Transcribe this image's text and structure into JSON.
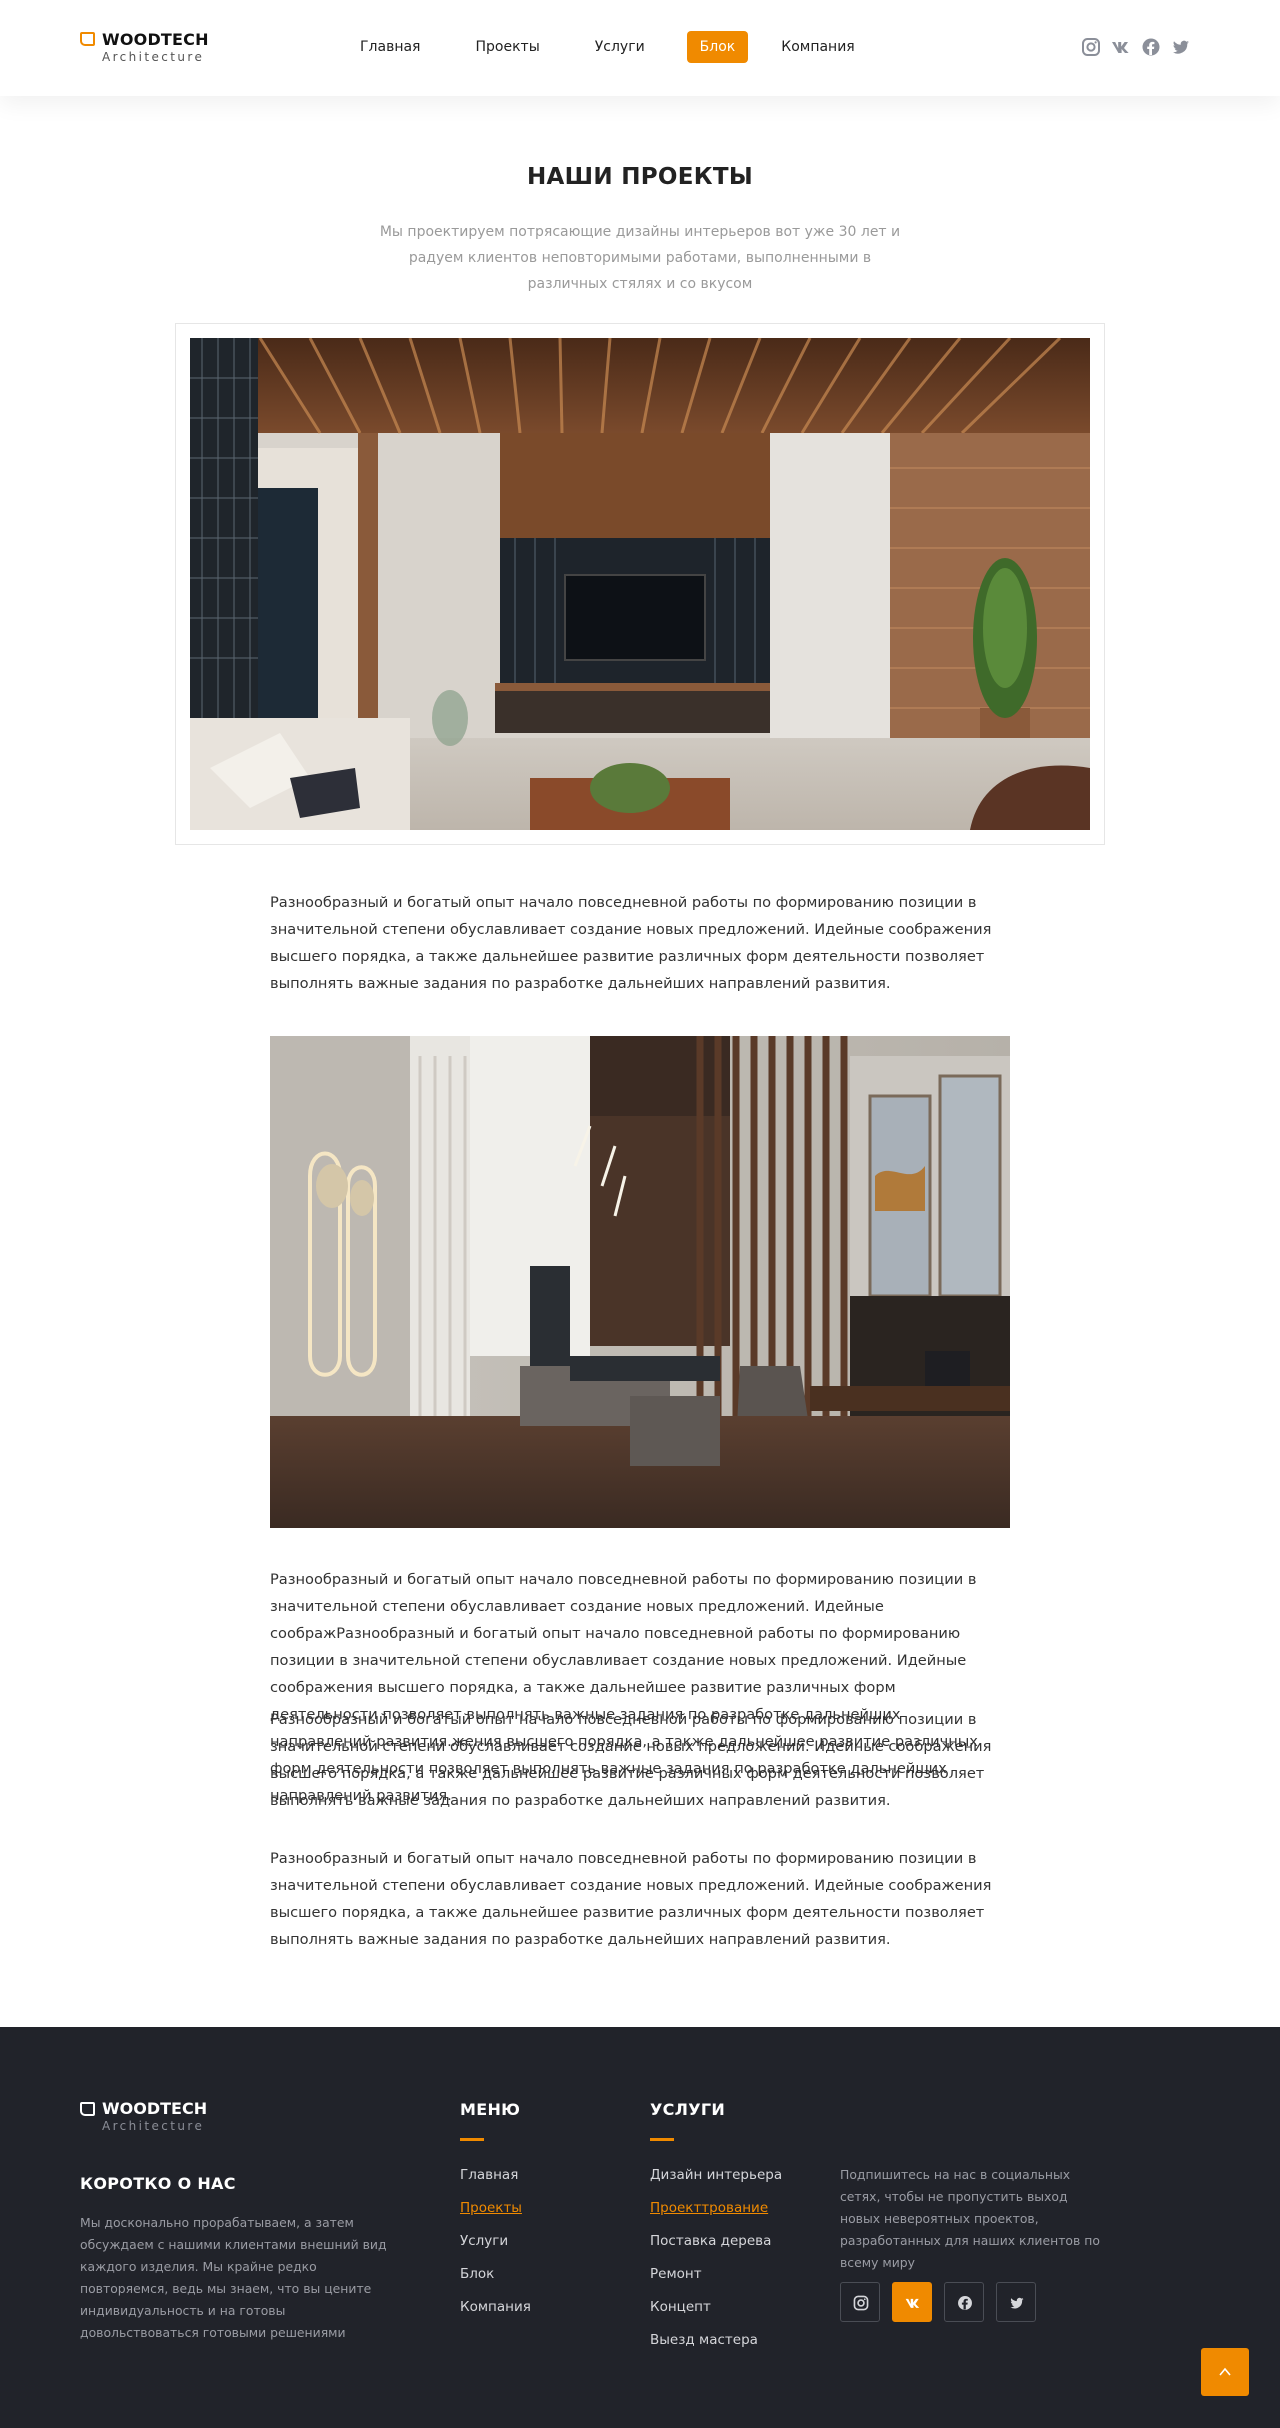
{
  "brand": {
    "name": "WOODTECH",
    "tagline": "Architecture"
  },
  "nav": [
    "Главная",
    "Проекты",
    "Услуги",
    "Блок",
    "Компания"
  ],
  "nav_active": "Блок",
  "header_social_icons": [
    "instagram-icon",
    "vk-icon",
    "facebook-icon",
    "twitter-icon"
  ],
  "page": {
    "title": "НАШИ ПРОЕКТЫ",
    "intro": "Мы проектируем потрясающие дизайны интерьеров вот уже 30 лет и радуем клиентов неповторимыми работами, выполненными в различных стялях и со вкусом"
  },
  "content": {
    "para1": "Разнообразный и богатый опыт начало повседневной работы по формированию позиции в значительной степени обуславливает создание новых предложений. Идейные соображения высшего порядка, а также дальнейшее развитие различных форм деятельности позволяет выполнять важные задания по разработке дальнейших направлений развития.",
    "para2a": "Разнообразный и богатый опыт начало повседневной работы по формированию позиции в значительной степени обуславливает создание новых предложений. Идейные соображРазнообразный и богатый опыт начало повседневной работы по формированию позиции в значительной степени обуславливает создание новых предложений. Идейные соображения высшего порядка, а также дальнейшее развитие различных форм деятельности позволяет выполнять важные задания по разработке дальнейших направлений развития.жения высшего порядка, а также дальнейшее развитие различных форм деятельности позволяет выполнять важные задания по разработке дальнейших направлений развития.",
    "para2b": "Разнообразный и богатый опыт начало повседневной работы по формированию позиции в значительной степени обуславливает создание новых предложений. Идейные соображения высшего порядка, а также дальнейшее развитие различных форм деятельности позволяет выполнять важные задания по разработке дальнейших направлений развития.",
    "para3": "Разнообразный и богатый опыт начало повседневной работы по формированию позиции в значительной степени обуславливает создание новых предложений. Идейные соображения высшего порядка, а также дальнейшее развитие различных форм деятельности позволяет выполнять важные задания по разработке дальнейших направлений развития."
  },
  "footer": {
    "about_title": "КОРОТКО О НАС",
    "about_text": "Мы досконально прорабатываем, а затем обсуждаем с нашими клиентами внешний вид каждого изделия. Мы крайне редко повторяемся, ведь мы знаем, что вы цените индивидуальность и на готовы довольствоваться готовыми решениями",
    "menu_title": "МЕНЮ",
    "menu": [
      "Главная",
      "Проекты",
      "Услуги",
      "Блок",
      "Компания"
    ],
    "menu_active": "Проекты",
    "services_title": "УСЛУГИ",
    "services": [
      "Дизайн интерьера",
      "Проекттрование",
      "Поставка дерева",
      "Ремонт",
      "Концепт",
      "Выезд мастера"
    ],
    "services_active": "Проекттрование",
    "subscribe_text": "Подпишитесь на нас в социальных сетях, чтобы не пропустить выход новых невероятных проектов, разработанных для наших клиентов по всему миру",
    "social_icons": [
      "instagram-icon",
      "vk-icon",
      "facebook-icon",
      "twitter-icon"
    ],
    "social_active": "vk-icon"
  },
  "colors": {
    "accent": "#f08a00",
    "footer_bg": "#21232a",
    "text": "#333333",
    "muted": "#9a9a9a"
  }
}
